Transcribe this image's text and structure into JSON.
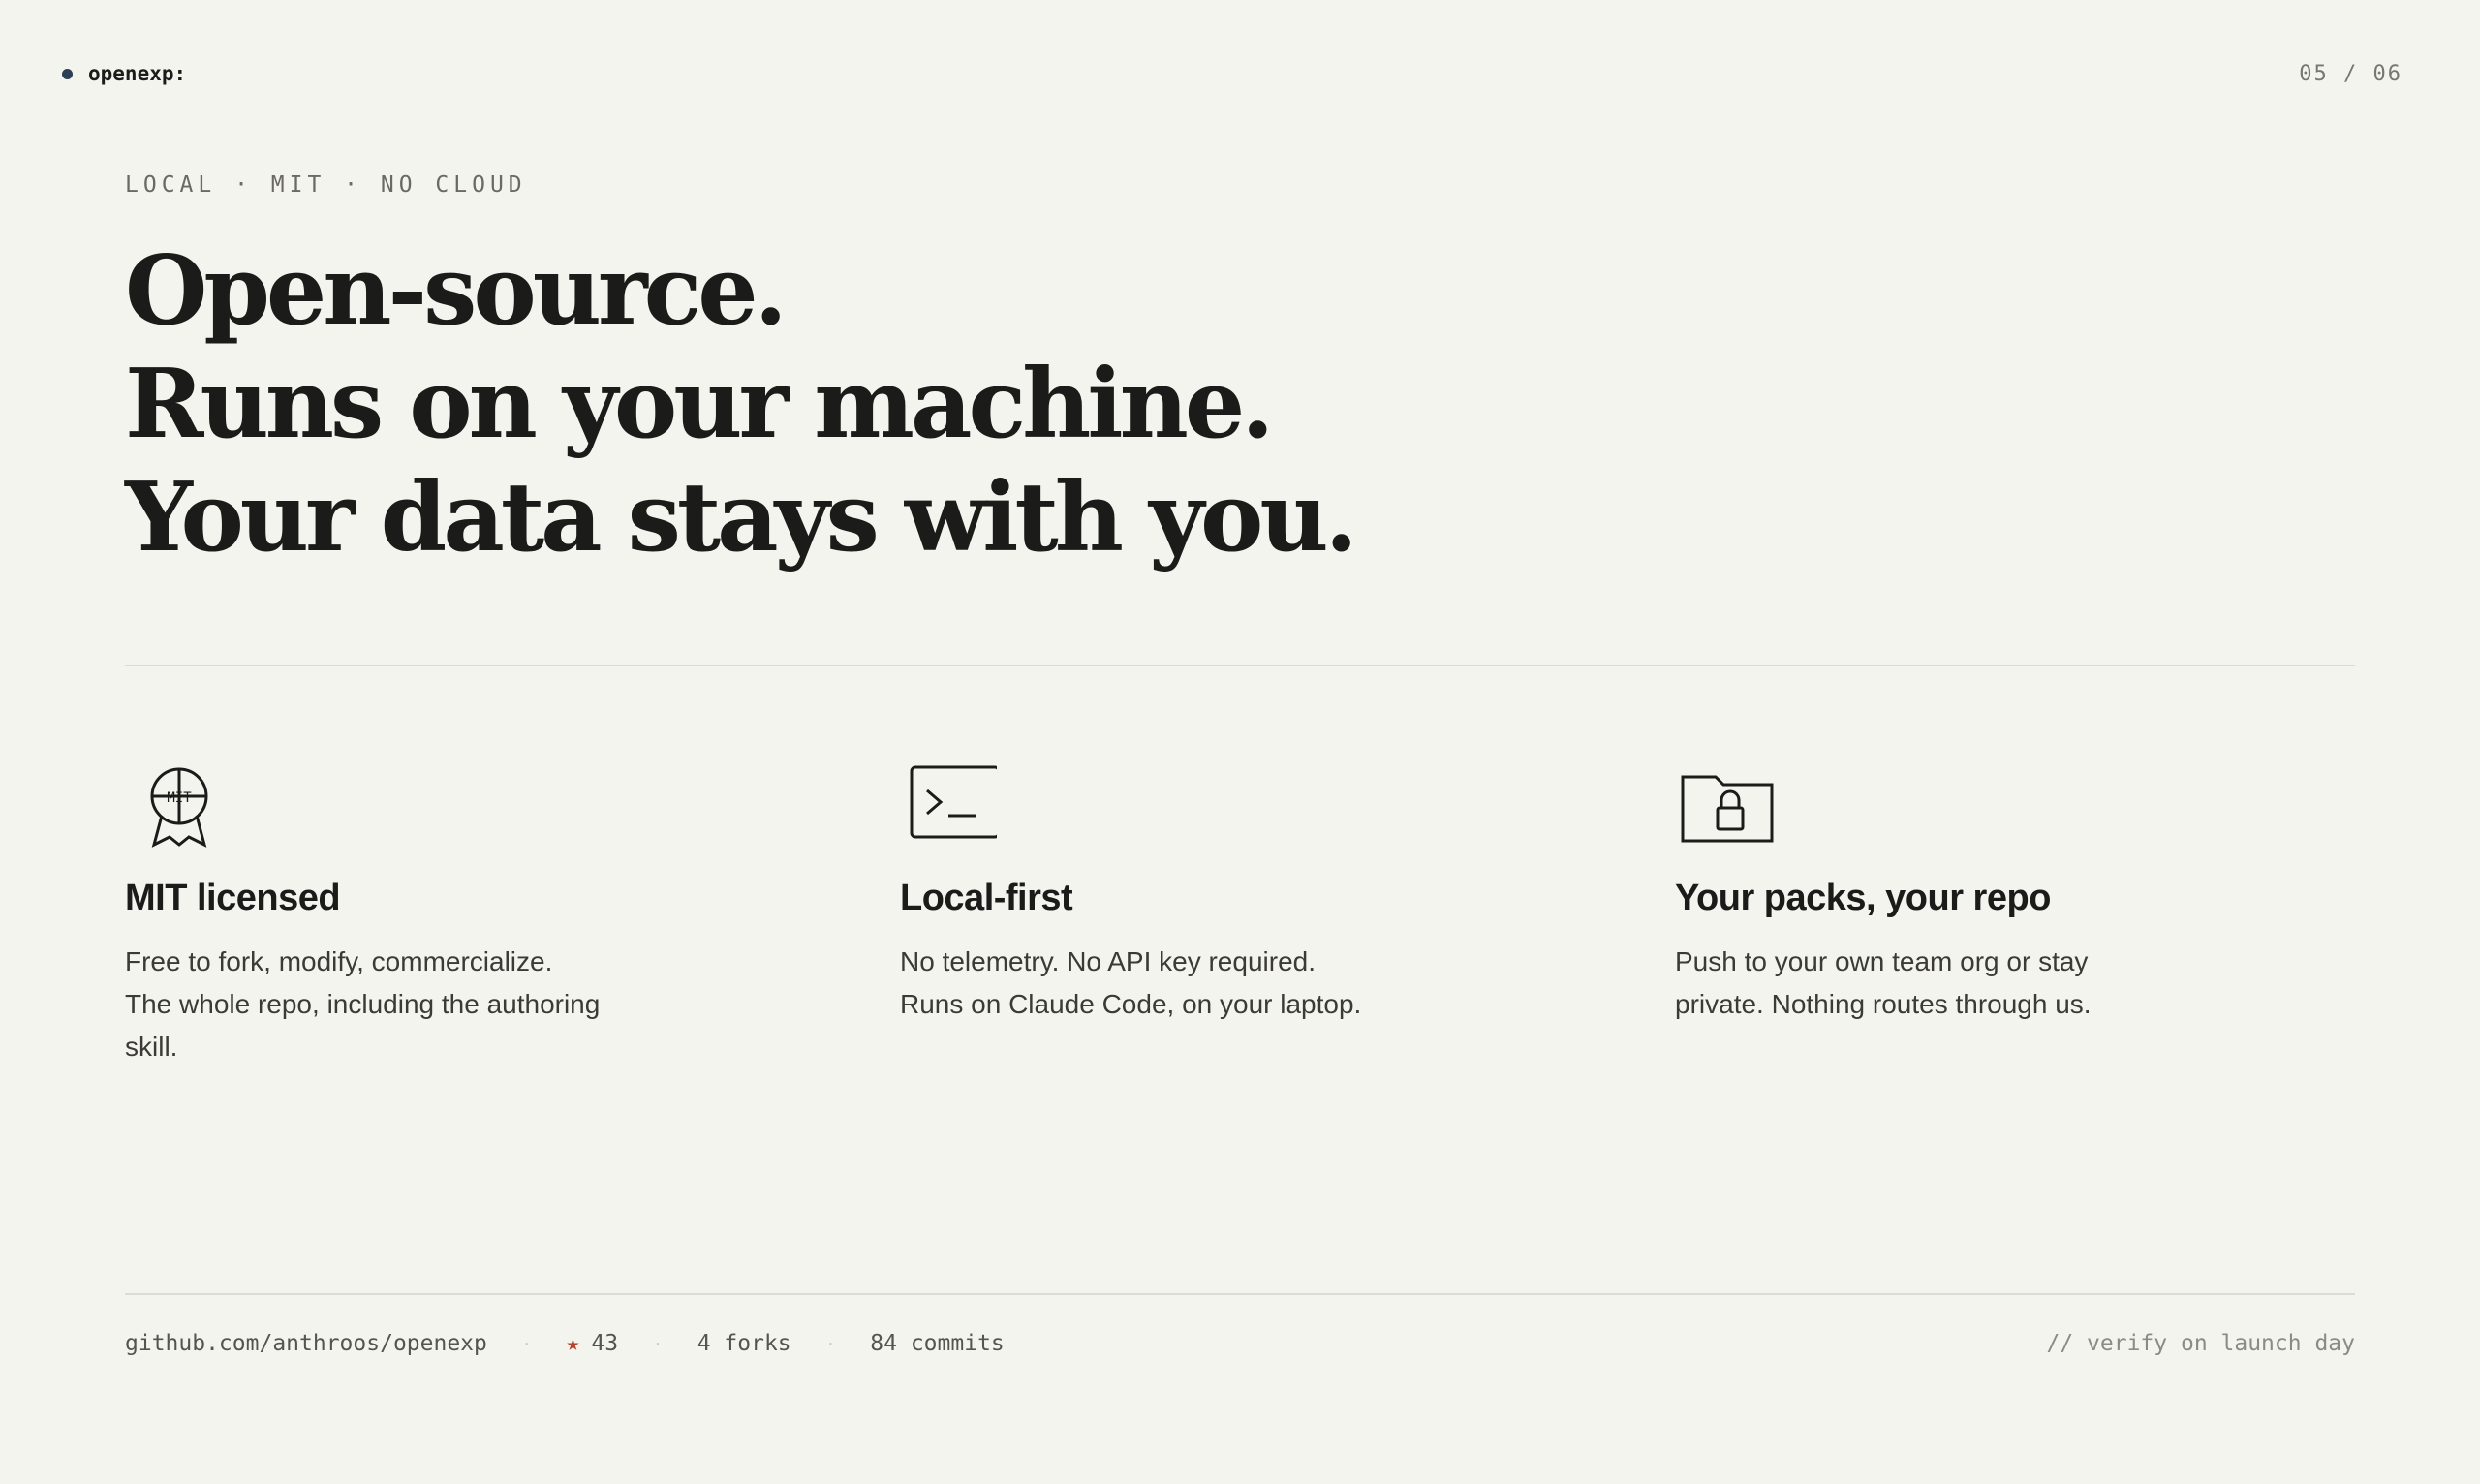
{
  "topbar": {
    "brand": "openexp:",
    "pager": "05 / 06"
  },
  "eyebrow": "LOCAL · MIT · NO CLOUD",
  "headline": {
    "line1": "Open-source.",
    "line2": "Runs on your machine.",
    "line3": "Your data stays with you."
  },
  "features": [
    {
      "icon": "mit-badge-icon",
      "icon_text": "MIT",
      "title": "MIT licensed",
      "line1": "Free to fork, modify, commercialize.",
      "line2": "The whole repo, including the authoring",
      "line3": "skill."
    },
    {
      "icon": "terminal-icon",
      "title": "Local-first",
      "line1": "No telemetry. No API key required.",
      "line2": "Runs on Claude Code, on your laptop."
    },
    {
      "icon": "locked-folder-icon",
      "title": "Your packs, your repo",
      "line1": "Push to your own team org or stay",
      "line2": "private. Nothing routes through us."
    }
  ],
  "footer": {
    "repo": "github.com/anthroos/openexp",
    "separator": "·",
    "stars": "43",
    "forks": "4 forks",
    "commits": "84 commits",
    "note": "// verify on launch day"
  },
  "colors": {
    "background": "#f4f4ef",
    "text": "#1b1b19",
    "brand_dot": "#2b3f55",
    "star": "#b5452f"
  }
}
